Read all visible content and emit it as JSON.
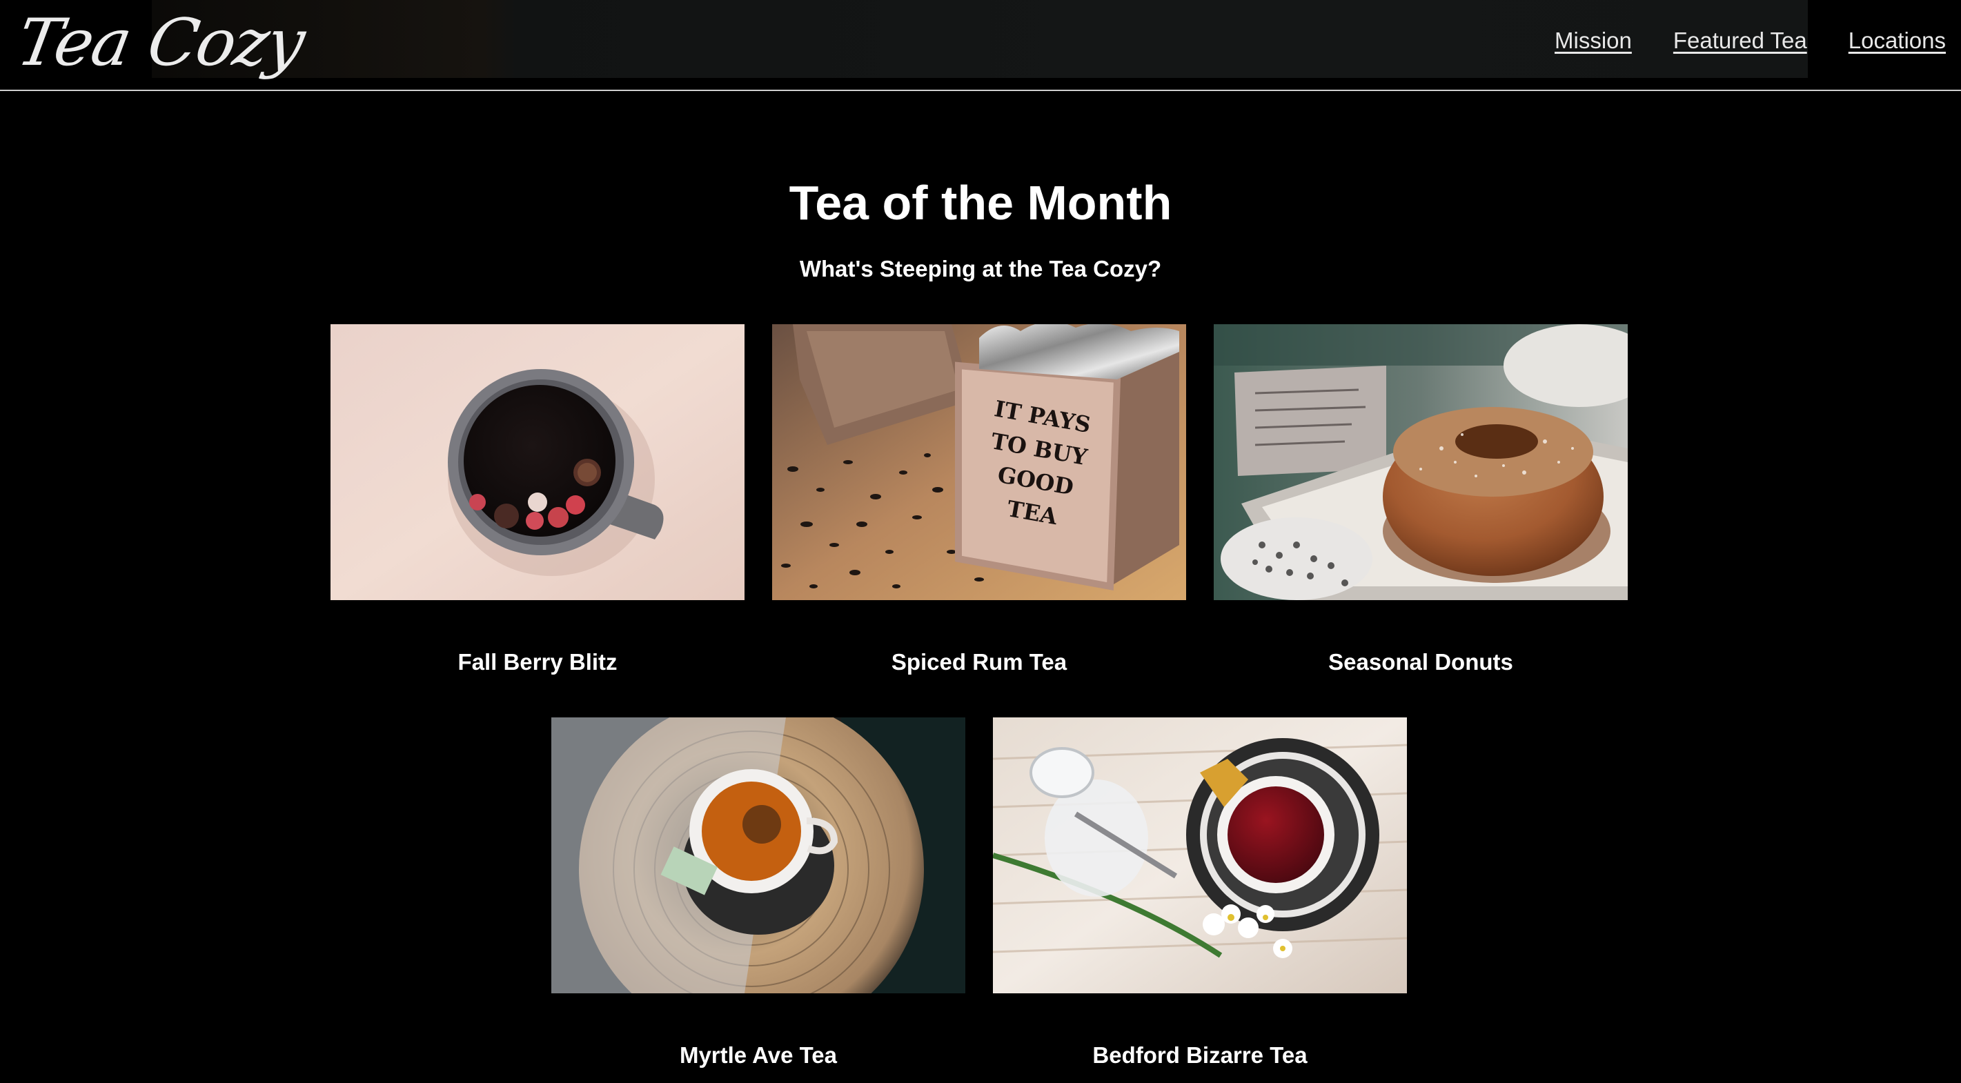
{
  "header": {
    "logo_text": "Tea Cozy",
    "nav": [
      {
        "label": "Mission"
      },
      {
        "label": "Featured Tea"
      },
      {
        "label": "Locations"
      }
    ]
  },
  "main": {
    "title": "Tea of the Month",
    "subtitle": "What's Steeping at the Tea Cozy?",
    "teas": [
      {
        "name": "Fall Berry Blitz",
        "image": "mug-with-berries-photo"
      },
      {
        "name": "Spiced Rum Tea",
        "image": "tea-box-photo",
        "box_text": [
          "IT PAYS",
          "TO BUY",
          "GOOD",
          "TEA"
        ]
      },
      {
        "name": "Seasonal Donuts",
        "image": "sugar-donut-photo"
      },
      {
        "name": "Myrtle Ave Tea",
        "image": "teacup-on-wood-photo"
      },
      {
        "name": "Bedford Bizarre Tea",
        "image": "red-tea-cup-photo"
      }
    ]
  },
  "colors": {
    "background": "#000000",
    "text": "#ffffff",
    "nav_link": "#e8e8e8",
    "header_rule": "#cfcfcf"
  }
}
